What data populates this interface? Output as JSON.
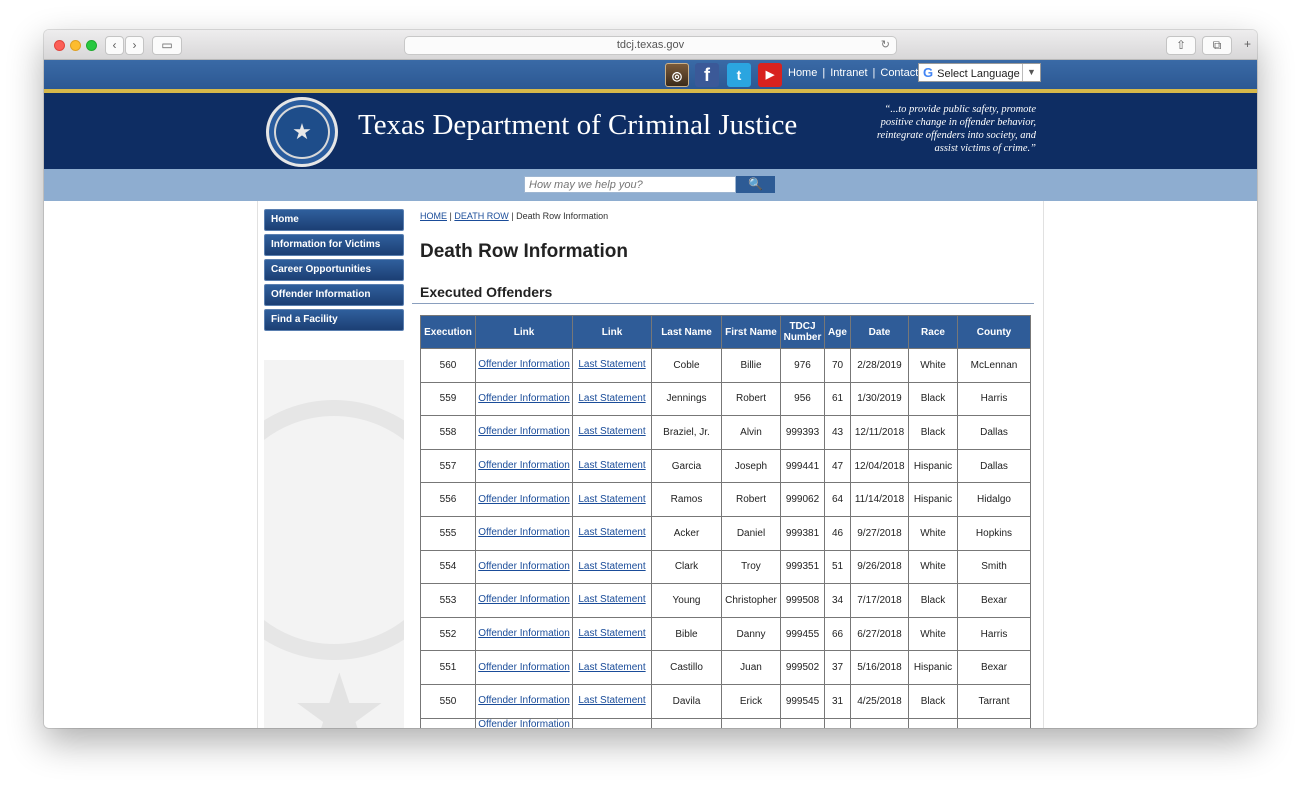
{
  "browser": {
    "url": "tdcj.texas.gov",
    "back_glyph": "‹",
    "forward_glyph": "›",
    "sidebar_glyph": "▭",
    "reload_glyph": "↻",
    "share_glyph": "⇧",
    "tabs_glyph": "⧉",
    "newtab_glyph": "+"
  },
  "topbar": {
    "social_glyphs": {
      "instagram": "◎",
      "facebook": "f",
      "twitter": "t",
      "youtube": "▶"
    },
    "links": [
      "Home",
      "Intranet",
      "Contact"
    ],
    "divider": "|",
    "language_label": "Select Language",
    "google_glyph": "G",
    "language_arrow": "▼"
  },
  "banner": {
    "title": "Texas Department of Criminal Justice",
    "mission": "“...to provide public safety, promote positive change in offender behavior, reintegrate offenders into society, and assist victims of crime.”",
    "seal_glyph": "★"
  },
  "search": {
    "placeholder": "How may we help you?",
    "button_glyph": "🔍"
  },
  "sidebar": {
    "items": [
      "Home",
      "Information for Victims",
      "Career Opportunities",
      "Offender Information",
      "Find a Facility"
    ]
  },
  "breadcrumb": {
    "home": "HOME",
    "death_row": "DEATH ROW",
    "current": "Death Row Information",
    "sep": "|"
  },
  "page": {
    "title": "Death Row Information",
    "section": "Executed Offenders"
  },
  "table": {
    "headers": [
      "Execution",
      "Link",
      "Link",
      "Last Name",
      "First Name",
      "TDCJ Number",
      "Age",
      "Date",
      "Race",
      "County"
    ],
    "offender_link": "Offender Information",
    "statement_link": "Last Statement",
    "rows": [
      [
        "560",
        "Coble",
        "Billie",
        "976",
        "70",
        "2/28/2019",
        "White",
        "McLennan"
      ],
      [
        "559",
        "Jennings",
        "Robert",
        "956",
        "61",
        "1/30/2019",
        "Black",
        "Harris"
      ],
      [
        "558",
        "Braziel, Jr.",
        "Alvin",
        "999393",
        "43",
        "12/11/2018",
        "Black",
        "Dallas"
      ],
      [
        "557",
        "Garcia",
        "Joseph",
        "999441",
        "47",
        "12/04/2018",
        "Hispanic",
        "Dallas"
      ],
      [
        "556",
        "Ramos",
        "Robert",
        "999062",
        "64",
        "11/14/2018",
        "Hispanic",
        "Hidalgo"
      ],
      [
        "555",
        "Acker",
        "Daniel",
        "999381",
        "46",
        "9/27/2018",
        "White",
        "Hopkins"
      ],
      [
        "554",
        "Clark",
        "Troy",
        "999351",
        "51",
        "9/26/2018",
        "White",
        "Smith"
      ],
      [
        "553",
        "Young",
        "Christopher",
        "999508",
        "34",
        "7/17/2018",
        "Black",
        "Bexar"
      ],
      [
        "552",
        "Bible",
        "Danny",
        "999455",
        "66",
        "6/27/2018",
        "White",
        "Harris"
      ],
      [
        "551",
        "Castillo",
        "Juan",
        "999502",
        "37",
        "5/16/2018",
        "Hispanic",
        "Bexar"
      ],
      [
        "550",
        "Davila",
        "Erick",
        "999545",
        "31",
        "4/25/2018",
        "Black",
        "Tarrant"
      ],
      [
        "",
        "",
        "",
        "",
        "",
        "",
        "",
        ""
      ]
    ]
  },
  "colors": {
    "navy": "#0e2d63",
    "header_blue": "#2f5c98",
    "link_blue": "#1a4c99",
    "search_band": "#8eadd0",
    "gold": "#d6b84a"
  }
}
